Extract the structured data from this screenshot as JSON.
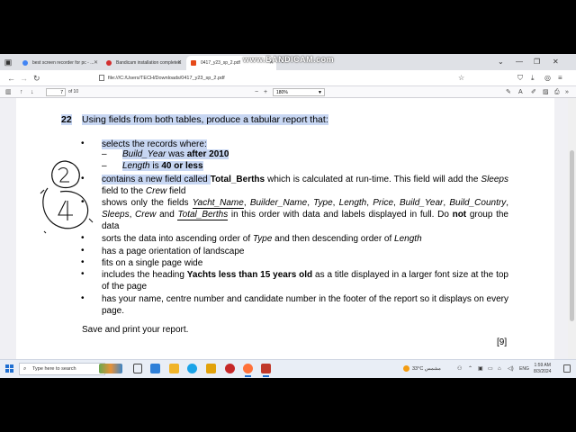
{
  "recorder": {
    "watermark": "www.BANDICAM.com"
  },
  "browser": {
    "tabs": [
      {
        "label": "best screen recorder for pc - ...",
        "favicon_color": "#4285f4",
        "active": false
      },
      {
        "label": "Bandicam installation completed",
        "favicon_color": "#d32f2f",
        "active": false
      },
      {
        "label": "0417_y23_sp_2.pdf",
        "favicon_color": "#e64a19",
        "active": true
      }
    ],
    "url": "file:///C:/Users/TECH/Downloads/0417_y23_sp_2.pdf"
  },
  "pdf_toolbar": {
    "current_page": "7",
    "page_count": "of 10",
    "zoom": "180%"
  },
  "document": {
    "question_number": "22",
    "question_text": "Using fields from both tables, produce a tabular report that:",
    "b1": "selects the records where:",
    "s1_field": "Build_Year",
    "s1_mid": " was ",
    "s1_value": "after 2010",
    "s2_field": "Length",
    "s2_mid": " is ",
    "s2_value": "40 or less",
    "b2_pre": "contains a new field called ",
    "b2_field": "Total_Berths",
    "b2_mid": " which is calculated at run-time. This field will add the ",
    "b2_f1": "Sleeps",
    "b2_mid2": " field to the ",
    "b2_f2": "Crew",
    "b2_post": " field",
    "b3_pre": "shows only the fields ",
    "b3_f1": "Yacht_Name",
    "b3_f2": "Builder_Name",
    "b3_f3": "Type",
    "b3_f4": "Length",
    "b3_f5": "Price",
    "b3_f6": "Build_Year",
    "b3_f7": "Build_Country",
    "b3_f8": "Sleeps",
    "b3_f9": "Crew",
    "b3_and": " and ",
    "b3_f10": "Total_Berths",
    "b3_post": " in this order with data and labels displayed in full. Do ",
    "b3_not": "not",
    "b3_end": " group the data",
    "b4_pre": "sorts the data into ascending order of ",
    "b4_f1": "Type",
    "b4_mid": " and then descending order of ",
    "b4_f2": "Length",
    "b5": "has a page orientation of landscape",
    "b6": "fits on a single page wide",
    "b7_pre": "includes the heading ",
    "b7_heading": "Yachts less than 15 years old",
    "b7_post": " as a title displayed in a larger font size at the top of the page",
    "b8": "has your name, centre number and candidate number in the footer of the report so it displays on every page.",
    "save": "Save and print your report.",
    "marks": "[9]"
  },
  "taskbar": {
    "search_placeholder": "Type here to search",
    "weather_temp": "33°C",
    "weather_text": "مشمس",
    "language": "ENG",
    "time": "1:59 AM",
    "date": "8/3/2024"
  }
}
